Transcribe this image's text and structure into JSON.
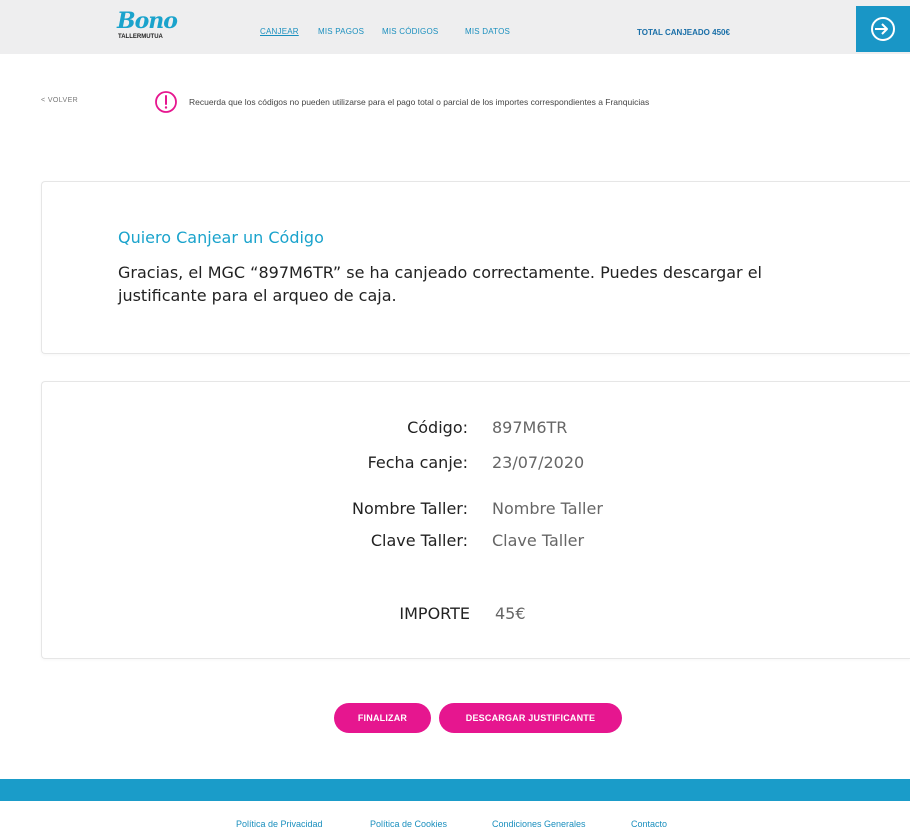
{
  "header": {
    "logo_main": "Bono",
    "logo_sub": "TALLERMUTUA",
    "nav": [
      "CANJEAR",
      "MIS PAGOS",
      "MIS CÓDIGOS",
      "MIS DATOS"
    ],
    "total": "TOTAL CANJEADO 450€",
    "logout_icon": "logout-arrow-icon"
  },
  "notice": {
    "back_label": "< VOLVER",
    "text": "Recuerda que los códigos no pueden utilizarse para el pago total o parcial de los importes correspondientes a Franquicias",
    "icon": "exclamation-circle-icon"
  },
  "confirmation": {
    "title": "Quiero Canjear un Código",
    "message": "Gracias, el MGC “897M6TR” se ha canjeado correctamente. Puedes descargar el justificante para el arqueo de caja."
  },
  "details": {
    "codigo_label": "Código:",
    "codigo_value": "897M6TR",
    "fecha_label": "Fecha canje:",
    "fecha_value": "23/07/2020",
    "nombre_label": "Nombre Taller:",
    "nombre_value": "Nombre Taller",
    "clave_label": "Clave Taller:",
    "clave_value": "Clave Taller",
    "importe_label": "IMPORTE",
    "importe_value": "45€"
  },
  "actions": {
    "finish_label": "FINALIZAR",
    "download_label": "DESCARGAR JUSTIFICANTE"
  },
  "footer": {
    "links": [
      "Política de Privacidad",
      "Política de Cookies",
      "Condiciones Generales",
      "Contacto"
    ]
  },
  "colors": {
    "brand_blue": "#1aa3cc",
    "accent_pink": "#e6168f",
    "header_bg": "#eeeeef"
  }
}
